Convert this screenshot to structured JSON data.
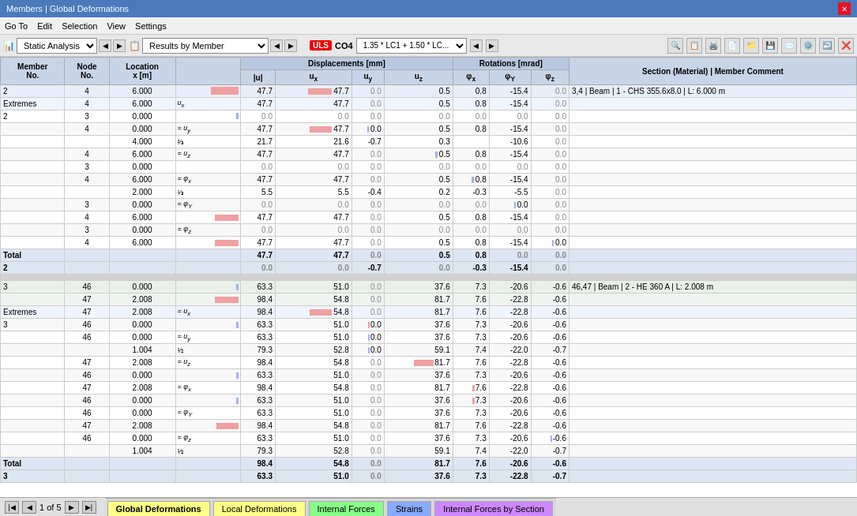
{
  "titlebar": {
    "title": "Members | Global Deformations",
    "close_label": "✕"
  },
  "menubar": {
    "items": [
      "Go To",
      "Edit",
      "Selection",
      "View",
      "Settings"
    ]
  },
  "toolbar": {
    "analysis_label": "Static Analysis",
    "results_label": "Results by Member",
    "uls_label": "ULS",
    "co_label": "CO4",
    "formula_label": "1.35 * LC1 + 1.50 * LC..."
  },
  "table": {
    "headers": {
      "member_no": "Member No.",
      "node_no": "Node No.",
      "location": "Location x [m]",
      "displacements": "Displacements [mm]",
      "abs_u": "|u|",
      "ux": "ux",
      "uy": "uy",
      "uz": "uz",
      "rotations": "Rotations [mrad]",
      "phi_x": "φx",
      "phi_y": "φY",
      "phi_z": "φz",
      "section": "Section (Material) | Member Comment"
    },
    "rows_member2": [
      {
        "member": "2",
        "node": "4",
        "loc": "6.000",
        "eq": "=",
        "abs_u": "47.7",
        "ux": "47.7",
        "uy": "0.0",
        "uz": "0.5",
        "phix": "0.8",
        "phiy": "-15.4",
        "phiz": "0.0",
        "comment": "3,4 | Beam | 1 - CHS 355.6x8.0 | L: 6.000 m",
        "type": "member"
      },
      {
        "member": "Extremes",
        "node": "4",
        "loc": "6.000",
        "eq": "= ux",
        "abs_u": "47.7",
        "ux": "47.7",
        "uy": "0.0",
        "uz": "0.5",
        "phix": "0.8",
        "phiy": "-15.4",
        "phiz": "0.0",
        "comment": "",
        "type": "extremes"
      },
      {
        "member": "2",
        "node": "3",
        "loc": "0.000",
        "eq": "=",
        "abs_u": "0.0",
        "ux": "0.0",
        "uy": "0.0",
        "uz": "0.0",
        "phix": "0.0",
        "phiy": "0.0",
        "phiz": "0.0",
        "comment": "",
        "type": "data"
      },
      {
        "member": "",
        "node": "4",
        "loc": "0.000",
        "eq": "= uy",
        "abs_u": "47.7",
        "ux": "47.7",
        "uy": "0.0",
        "uz": "0.5",
        "phix": "0.8",
        "phiy": "-15.4",
        "phiz": "0.0",
        "comment": "",
        "type": "data"
      },
      {
        "member": "",
        "node": "",
        "loc": "4.000",
        "eq": "2/3",
        "abs_u": "21.7",
        "ux": "21.6",
        "uy": "-0.7",
        "uz": "0.3",
        "phix": "",
        "phiy": "-10.6",
        "phiz": "0.0",
        "comment": "",
        "type": "data"
      },
      {
        "member": "",
        "node": "4",
        "loc": "6.000",
        "eq": "= uz",
        "abs_u": "47.7",
        "ux": "47.7",
        "uy": "0.0",
        "uz": "0.5",
        "phix": "0.8",
        "phiy": "-15.4",
        "phiz": "0.0",
        "comment": "",
        "type": "data"
      },
      {
        "member": "",
        "node": "3",
        "loc": "0.000",
        "eq": "=",
        "abs_u": "0.0",
        "ux": "0.0",
        "uy": "0.0",
        "uz": "0.0",
        "phix": "0.0",
        "phiy": "0.0",
        "phiz": "0.0",
        "comment": "",
        "type": "data"
      },
      {
        "member": "",
        "node": "4",
        "loc": "6.000",
        "eq": "= φx",
        "abs_u": "47.7",
        "ux": "47.7",
        "uy": "0.0",
        "uz": "0.5",
        "phix": "0.8",
        "phiy": "-15.4",
        "phiz": "0.0",
        "comment": "",
        "type": "data"
      },
      {
        "member": "",
        "node": "",
        "loc": "2.000",
        "eq": "1/3",
        "abs_u": "5.5",
        "ux": "5.5",
        "uy": "-0.4",
        "uz": "0.2",
        "phix": "-0.3",
        "phiy": "-5.5",
        "phiz": "0.0",
        "comment": "",
        "type": "data"
      },
      {
        "member": "",
        "node": "3",
        "loc": "0.000",
        "eq": "= φY",
        "abs_u": "0.0",
        "ux": "0.0",
        "uy": "0.0",
        "uz": "0.0",
        "phix": "0.0",
        "phiy": "0.0",
        "phiz": "0.0",
        "comment": "",
        "type": "data"
      },
      {
        "member": "",
        "node": "4",
        "loc": "6.000",
        "eq": "=",
        "abs_u": "47.7",
        "ux": "47.7",
        "uy": "0.0",
        "uz": "0.5",
        "phix": "0.8",
        "phiy": "-15.4",
        "phiz": "0.0",
        "comment": "",
        "type": "data"
      },
      {
        "member": "",
        "node": "3",
        "loc": "0.000",
        "eq": "= φz",
        "abs_u": "0.0",
        "ux": "0.0",
        "uy": "0.0",
        "uz": "0.0",
        "phix": "0.0",
        "phiy": "0.0",
        "phiz": "0.0",
        "comment": "",
        "type": "data"
      },
      {
        "member": "",
        "node": "4",
        "loc": "6.000",
        "eq": "=",
        "abs_u": "47.7",
        "ux": "47.7",
        "uy": "0.0",
        "uz": "0.5",
        "phix": "0.8",
        "phiy": "-15.4",
        "phiz": "0.0",
        "comment": "",
        "type": "data"
      },
      {
        "member": "Total",
        "node": "",
        "loc": "",
        "eq": "",
        "abs_u": "47.7",
        "ux": "47.7",
        "uy": "0.0",
        "uz": "0.5",
        "phix": "0.8",
        "phiy": "0.0",
        "phiz": "0.0",
        "comment": "",
        "type": "total"
      },
      {
        "member": "2",
        "node": "",
        "loc": "",
        "eq": "",
        "abs_u": "0.0",
        "ux": "0.0",
        "uy": "-0.7",
        "uz": "0.0",
        "phix": "-0.3",
        "phiy": "-15.4",
        "phiz": "0.0",
        "comment": "",
        "type": "total2"
      }
    ],
    "rows_member3": [
      {
        "member": "3",
        "node": "46",
        "loc": "0.000",
        "eq": "=",
        "abs_u": "63.3",
        "ux": "51.0",
        "uy": "0.0",
        "uz": "37.6",
        "phix": "7.3",
        "phiy": "-20.6",
        "phiz": "-0.6",
        "comment": "46,47 | Beam | 2 - HE 360 A | L: 2.008 m",
        "type": "member3"
      },
      {
        "member": "",
        "node": "47",
        "loc": "2.008",
        "eq": "=",
        "abs_u": "98.4",
        "ux": "54.8",
        "uy": "0.0",
        "uz": "81.7",
        "phix": "7.6",
        "phiy": "-22.8",
        "phiz": "-0.6",
        "comment": "",
        "type": "data3"
      },
      {
        "member": "Extremes",
        "node": "47",
        "loc": "2.008",
        "eq": "= ux",
        "abs_u": "98.4",
        "ux": "54.8",
        "uy": "0.0",
        "uz": "81.7",
        "phix": "7.6",
        "phiy": "-22.8",
        "phiz": "-0.6",
        "comment": "",
        "type": "extremes3"
      },
      {
        "member": "3",
        "node": "46",
        "loc": "0.000",
        "eq": "=",
        "abs_u": "63.3",
        "ux": "51.0",
        "uy": "0.0",
        "uz": "37.6",
        "phix": "7.3",
        "phiy": "-20.6",
        "phiz": "-0.6",
        "comment": "",
        "type": "data3"
      },
      {
        "member": "",
        "node": "46",
        "loc": "0.000",
        "eq": "= uy",
        "abs_u": "63.3",
        "ux": "51.0",
        "uy": "0.0",
        "uz": "37.6",
        "phix": "7.3",
        "phiy": "-20.6",
        "phiz": "-0.6",
        "comment": "",
        "type": "data3"
      },
      {
        "member": "",
        "node": "",
        "loc": "1.004",
        "eq": "1/2",
        "abs_u": "79.3",
        "ux": "52.8",
        "uy": "0.0",
        "uz": "59.1",
        "phix": "7.4",
        "phiy": "-22.0",
        "phiz": "-0.7",
        "comment": "",
        "type": "data3"
      },
      {
        "member": "",
        "node": "47",
        "loc": "2.008",
        "eq": "= uz",
        "abs_u": "98.4",
        "ux": "54.8",
        "uy": "0.0",
        "uz": "81.7",
        "phix": "7.6",
        "phiy": "-22.8",
        "phiz": "-0.6",
        "comment": "",
        "type": "data3"
      },
      {
        "member": "",
        "node": "46",
        "loc": "0.000",
        "eq": "=",
        "abs_u": "63.3",
        "ux": "51.0",
        "uy": "0.0",
        "uz": "37.6",
        "phix": "7.3",
        "phiy": "-20.6",
        "phiz": "-0.6",
        "comment": "",
        "type": "data3"
      },
      {
        "member": "",
        "node": "47",
        "loc": "2.008",
        "eq": "= φx",
        "abs_u": "98.4",
        "ux": "54.8",
        "uy": "0.0",
        "uz": "81.7",
        "phix": "7.6",
        "phiy": "-22.8",
        "phiz": "-0.6",
        "comment": "",
        "type": "data3"
      },
      {
        "member": "",
        "node": "46",
        "loc": "0.000",
        "eq": "=",
        "abs_u": "63.3",
        "ux": "51.0",
        "uy": "0.0",
        "uz": "37.6",
        "phix": "7.3",
        "phiy": "-20.6",
        "phiz": "-0.6",
        "comment": "",
        "type": "data3"
      },
      {
        "member": "",
        "node": "46",
        "loc": "0.000",
        "eq": "= φY",
        "abs_u": "63.3",
        "ux": "51.0",
        "uy": "0.0",
        "uz": "37.6",
        "phix": "7.3",
        "phiy": "-20.6",
        "phiz": "-0.6",
        "comment": "",
        "type": "data3"
      },
      {
        "member": "",
        "node": "47",
        "loc": "2.008",
        "eq": "=",
        "abs_u": "98.4",
        "ux": "54.8",
        "uy": "0.0",
        "uz": "81.7",
        "phix": "7.6",
        "phiy": "-22.8",
        "phiz": "-0.6",
        "comment": "",
        "type": "data3"
      },
      {
        "member": "",
        "node": "46",
        "loc": "0.000",
        "eq": "= φz",
        "abs_u": "63.3",
        "ux": "51.0",
        "uy": "0.0",
        "uz": "37.6",
        "phix": "7.3",
        "phiy": "-20.6",
        "phiz": "-0.6",
        "comment": "",
        "type": "data3"
      },
      {
        "member": "",
        "node": "",
        "loc": "1.004",
        "eq": "1/2",
        "abs_u": "79.3",
        "ux": "52.8",
        "uy": "0.0",
        "uz": "59.1",
        "phix": "7.4",
        "phiy": "-22.0",
        "phiz": "-0.7",
        "comment": "",
        "type": "data3"
      },
      {
        "member": "Total",
        "node": "",
        "loc": "",
        "eq": "",
        "abs_u": "98.4",
        "ux": "54.8",
        "uy": "0.0",
        "uz": "81.7",
        "phix": "7.6",
        "phiy": "-20.6",
        "phiz": "-0.6",
        "comment": "",
        "type": "total3"
      },
      {
        "member": "3",
        "node": "",
        "loc": "",
        "eq": "",
        "abs_u": "63.3",
        "ux": "51.0",
        "uy": "0.0",
        "uz": "37.6",
        "phix": "7.3",
        "phiy": "-22.8",
        "phiz": "-0.7",
        "comment": "",
        "type": "total3b"
      }
    ]
  },
  "statusbar": {
    "page_info": "1 of 5"
  },
  "bottom_tabs": [
    {
      "label": "Global Deformations",
      "active": true,
      "color": "yellow"
    },
    {
      "label": "Local Deformations",
      "active": false,
      "color": "yellow"
    },
    {
      "label": "Internal Forces",
      "active": false,
      "color": "green"
    },
    {
      "label": "Strains",
      "active": false,
      "color": "blue"
    },
    {
      "label": "Internal Forces by Section",
      "active": false,
      "color": "purple"
    }
  ]
}
